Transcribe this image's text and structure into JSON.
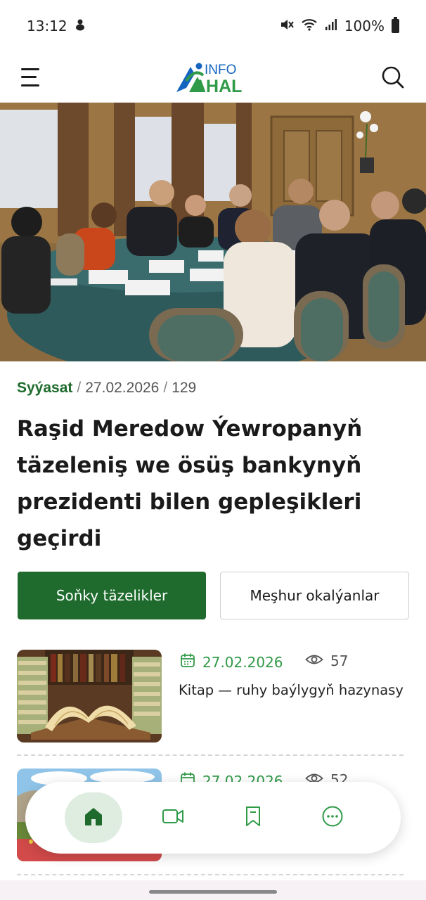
{
  "status_bar": {
    "time": "13:12",
    "battery": "100%",
    "icons": [
      "notification-icon",
      "mute-icon",
      "wifi-icon",
      "signal-icon",
      "battery-icon"
    ]
  },
  "header": {
    "logo_top": "INFO",
    "logo_bottom": "AHAL",
    "menu_icon": "hamburger-menu-icon",
    "search_icon": "search-icon"
  },
  "article": {
    "category": "Syýasat",
    "date": "27.02.2026",
    "views": "129",
    "separator": "/",
    "title": "Raşid Meredow Ýewropanyň täzeleniş we ösüş bankynyň prezidenti bilen gepleşikleri geçirdi"
  },
  "tabs": {
    "latest": "Soňky täzelikler",
    "popular": "Meşhur okalýanlar"
  },
  "news": [
    {
      "date": "27.02.2026",
      "views": "57",
      "title": "Kitap — ruhy baýlygyň hazynasy"
    },
    {
      "date": "27.02.2026",
      "views": "52",
      "title": ""
    }
  ],
  "bottom_nav": {
    "items": [
      "home-icon",
      "video-icon",
      "bookmark-icon",
      "more-icon"
    ],
    "active": "home-icon"
  },
  "colors": {
    "brand_green": "#1e6b2d",
    "accent_green": "#2f9a47",
    "active_nav_bg": "#dfece0"
  }
}
